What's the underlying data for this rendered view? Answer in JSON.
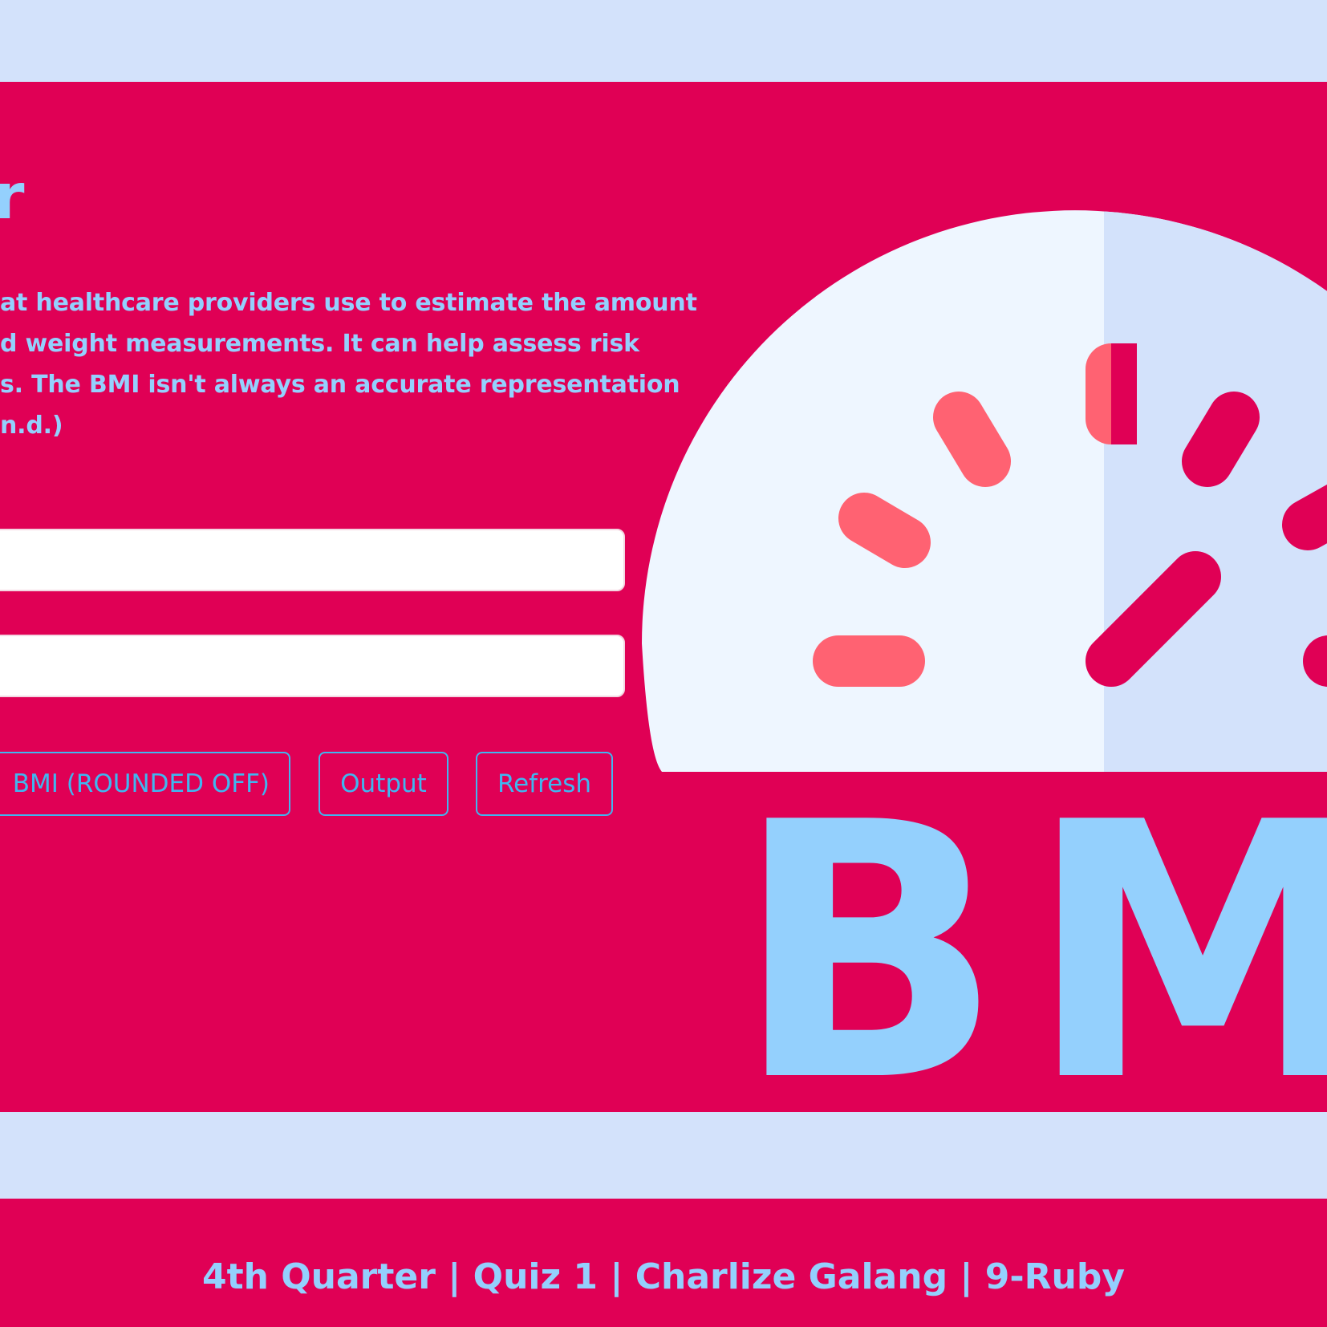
{
  "header": {
    "title_fragment": "r"
  },
  "description": {
    "lines": [
      "at healthcare providers use to estimate the amount",
      "d weight measurements. It can help assess risk",
      "s. The BMI isn't always an accurate representation",
      "n.d.)"
    ]
  },
  "form": {
    "height_value": "",
    "weight_value": ""
  },
  "buttons": {
    "bmi_label": "BMI (ROUNDED OFF)",
    "output_label": "Output",
    "refresh_label": "Refresh"
  },
  "logo": {
    "text": "BM"
  },
  "footer": {
    "text": "4th Quarter | Quiz 1 | Charlize Galang | 9-Ruby"
  },
  "colors": {
    "primary": "#e00055",
    "background": "#d3e2fb",
    "text_light_blue": "#94d0fd",
    "button_blue": "#3fb7f0",
    "gauge_white": "#eef6ff",
    "gauge_shade": "#d3e2fb",
    "tick_coral": "#ff6272"
  }
}
